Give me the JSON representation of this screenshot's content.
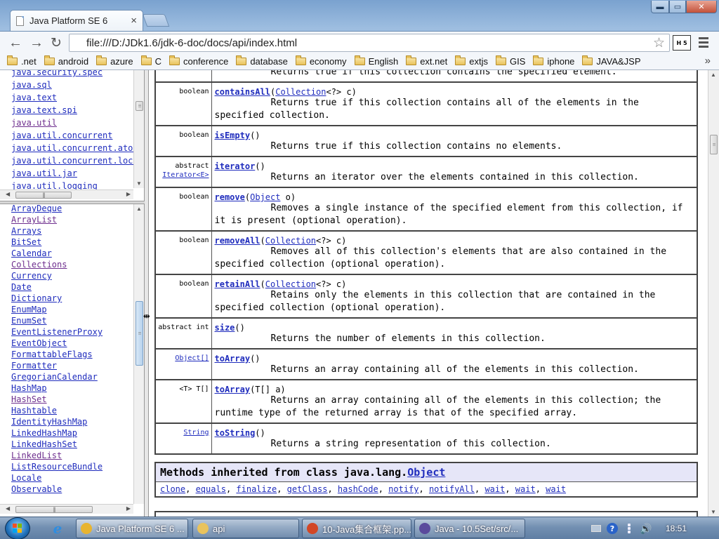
{
  "browser": {
    "tab_title": "Java Platform SE 6",
    "tab_close": "×",
    "url": "file:///D:/JDk1.6/jdk-6-doc/docs/api/index.html",
    "window_controls": {
      "minimize": "▬",
      "maximize": "▭",
      "close": "✕"
    },
    "nav": {
      "back": "←",
      "forward": "→",
      "reload": "↻",
      "star": "☆"
    },
    "extension_label": "H 5",
    "bookmarks": [
      ".net",
      "android",
      "azure",
      "C",
      "conference",
      "database",
      "economy",
      "English",
      "ext.net",
      "extjs",
      "GIS",
      "iphone",
      "JAVA&JSP"
    ],
    "bookmarks_overflow": "»"
  },
  "package_frame": {
    "packages": [
      {
        "name": "java.security.spec",
        "visited": false
      },
      {
        "name": "java.sql",
        "visited": false
      },
      {
        "name": "java.text",
        "visited": false
      },
      {
        "name": "java.text.spi",
        "visited": false
      },
      {
        "name": "java.util",
        "visited": true
      },
      {
        "name": "java.util.concurrent",
        "visited": false
      },
      {
        "name": "java.util.concurrent.atomic",
        "visited": false
      },
      {
        "name": "java.util.concurrent.locks",
        "visited": false
      },
      {
        "name": "java.util.jar",
        "visited": false
      },
      {
        "name": "java.util.logging",
        "visited": false
      }
    ]
  },
  "class_frame": {
    "classes": [
      {
        "name": "ArrayDeque",
        "visited": false
      },
      {
        "name": "ArrayList",
        "visited": true
      },
      {
        "name": "Arrays",
        "visited": false
      },
      {
        "name": "BitSet",
        "visited": false
      },
      {
        "name": "Calendar",
        "visited": false
      },
      {
        "name": "Collections",
        "visited": true
      },
      {
        "name": "Currency",
        "visited": false
      },
      {
        "name": "Date",
        "visited": false
      },
      {
        "name": "Dictionary",
        "visited": false
      },
      {
        "name": "EnumMap",
        "visited": false
      },
      {
        "name": "EnumSet",
        "visited": false
      },
      {
        "name": "EventListenerProxy",
        "visited": false
      },
      {
        "name": "EventObject",
        "visited": false
      },
      {
        "name": "FormattableFlags",
        "visited": false
      },
      {
        "name": "Formatter",
        "visited": false
      },
      {
        "name": "GregorianCalendar",
        "visited": false
      },
      {
        "name": "HashMap",
        "visited": false
      },
      {
        "name": "HashSet",
        "visited": true
      },
      {
        "name": "Hashtable",
        "visited": false
      },
      {
        "name": "IdentityHashMap",
        "visited": false
      },
      {
        "name": "LinkedHashMap",
        "visited": false
      },
      {
        "name": "LinkedHashSet",
        "visited": false
      },
      {
        "name": "LinkedList",
        "visited": true
      },
      {
        "name": "ListResourceBundle",
        "visited": false
      },
      {
        "name": "Locale",
        "visited": false
      },
      {
        "name": "Observable",
        "visited": false
      }
    ]
  },
  "method_summary": {
    "partial_top_line": "Returns true if this collection contains the specified element.",
    "rows": [
      {
        "modifier": "boolean",
        "modifier_link": "",
        "name": "containsAll",
        "params_pre": "(",
        "param_type": "Collection",
        "params_post": "<?> c)",
        "description": "Returns true if this collection contains all of the elements in the specified collection."
      },
      {
        "modifier": "boolean",
        "modifier_link": "",
        "name": "isEmpty",
        "params_pre": "()",
        "param_type": "",
        "params_post": "",
        "description": "Returns true if this collection contains no elements."
      },
      {
        "modifier": "abstract",
        "modifier_link": "Iterator<E>",
        "name": "iterator",
        "params_pre": "()",
        "param_type": "",
        "params_post": "",
        "description": "Returns an iterator over the elements contained in this collection."
      },
      {
        "modifier": "boolean",
        "modifier_link": "",
        "name": "remove",
        "params_pre": "(",
        "param_type": "Object",
        "params_post": " o)",
        "description": "Removes a single instance of the specified element from this collection, if it is present (optional operation)."
      },
      {
        "modifier": "boolean",
        "modifier_link": "",
        "name": "removeAll",
        "params_pre": "(",
        "param_type": "Collection",
        "params_post": "<?> c)",
        "description": "Removes all of this collection's elements that are also contained in the specified collection (optional operation)."
      },
      {
        "modifier": "boolean",
        "modifier_link": "",
        "name": "retainAll",
        "params_pre": "(",
        "param_type": "Collection",
        "params_post": "<?> c)",
        "description": "Retains only the elements in this collection that are contained in the specified collection (optional operation)."
      },
      {
        "modifier": "abstract int",
        "modifier_link": "",
        "name": "size",
        "params_pre": "()",
        "param_type": "",
        "params_post": "",
        "description": "Returns the number of elements in this collection."
      },
      {
        "modifier": "",
        "modifier_link": "Object[]",
        "name": "toArray",
        "params_pre": "()",
        "param_type": "",
        "params_post": "",
        "description": "Returns an array containing all of the elements in this collection."
      },
      {
        "modifier": "<T> T[]",
        "modifier_link": "",
        "name": "toArray",
        "params_pre": "(T[] a)",
        "param_type": "",
        "params_post": "",
        "description": "Returns an array containing all of the elements in this collection; the runtime type of the returned array is that of the specified array."
      },
      {
        "modifier": "",
        "modifier_link": "String",
        "name": "toString",
        "params_pre": "()",
        "param_type": "",
        "params_post": "",
        "description": "Returns a string representation of this collection."
      }
    ]
  },
  "inherited": {
    "heading": "Methods inherited from class java.lang.",
    "heading_link": "Object",
    "methods": [
      "clone",
      "equals",
      "finalize",
      "getClass",
      "hashCode",
      "notify",
      "notifyAll",
      "wait",
      "wait",
      "wait"
    ]
  },
  "taskbar": {
    "items": [
      {
        "id": "chrome",
        "label": "Java Platform SE 6 ...",
        "active": true,
        "icon_color": "#e8b430"
      },
      {
        "id": "api",
        "label": "api",
        "active": false,
        "icon_color": "#e9c35d"
      },
      {
        "id": "ppt",
        "label": "10-Java集合框架.pp...",
        "active": false,
        "icon_color": "#d24726"
      },
      {
        "id": "eclipse",
        "label": "Java - 10.5Set/src/...",
        "active": false,
        "icon_color": "#5a4a9c"
      }
    ],
    "help_icon": "?",
    "speaker_icon": "🔊",
    "clock": "18:51"
  },
  "colors": {
    "link": "#1f2cbd",
    "visited_link": "#6e2f8e",
    "inherited_header_bg": "#e6e6f8"
  },
  "icons": {
    "tab": "page-icon",
    "back": "back-arrow-icon",
    "forward": "forward-arrow-icon",
    "reload": "reload-icon",
    "star": "star-icon",
    "menu": "hamburger-menu-icon",
    "folder": "folder-icon",
    "start": "windows-start-icon",
    "ie": "internet-explorer-icon",
    "keyboard": "keyboard-icon",
    "help": "help-icon",
    "network": "network-icon",
    "speaker": "speaker-icon"
  }
}
